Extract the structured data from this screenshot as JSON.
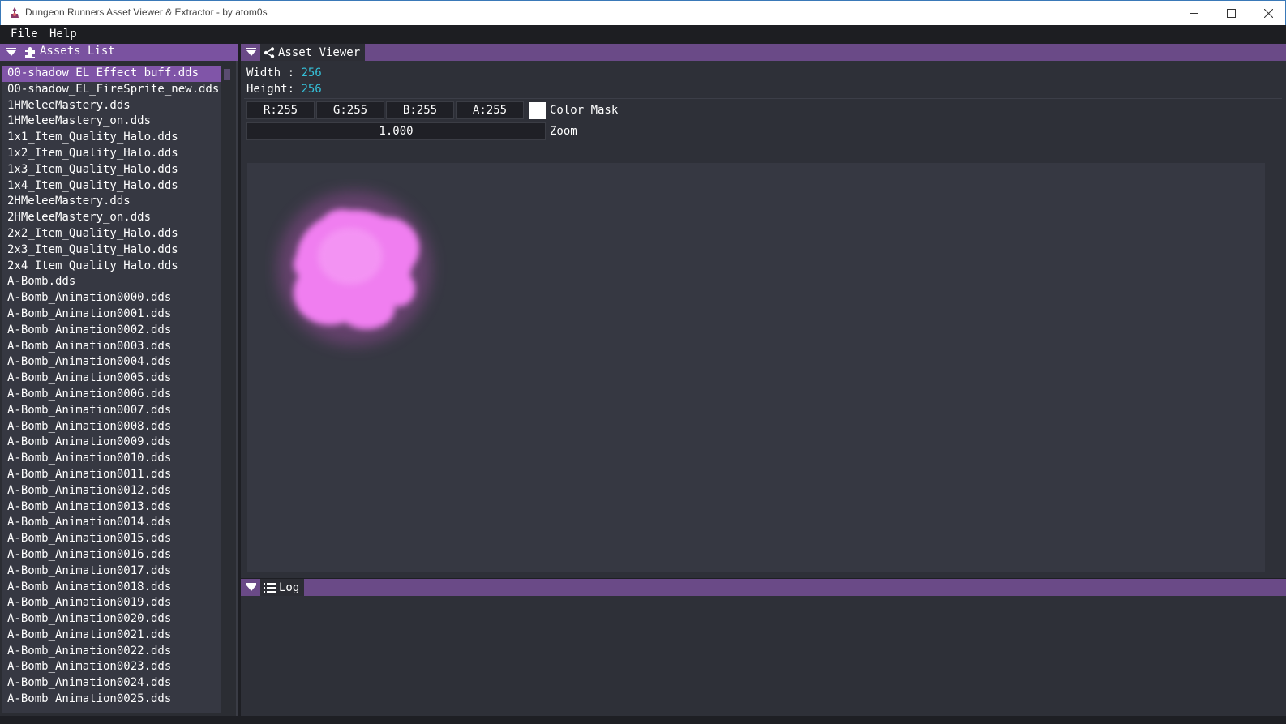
{
  "window": {
    "title": "Dungeon Runners Asset Viewer & Extractor - by atom0s"
  },
  "menu": [
    "File",
    "Help"
  ],
  "assets_panel": {
    "title": "Assets List",
    "selected_index": 0,
    "items": [
      "00-shadow_EL_Effect_buff.dds",
      "00-shadow_EL_FireSprite_new.dds",
      "1HMeleeMastery.dds",
      "1HMeleeMastery_on.dds",
      "1x1_Item_Quality_Halo.dds",
      "1x2_Item_Quality_Halo.dds",
      "1x3_Item_Quality_Halo.dds",
      "1x4_Item_Quality_Halo.dds",
      "2HMeleeMastery.dds",
      "2HMeleeMastery_on.dds",
      "2x2_Item_Quality_Halo.dds",
      "2x3_Item_Quality_Halo.dds",
      "2x4_Item_Quality_Halo.dds",
      "A-Bomb.dds",
      "A-Bomb_Animation0000.dds",
      "A-Bomb_Animation0001.dds",
      "A-Bomb_Animation0002.dds",
      "A-Bomb_Animation0003.dds",
      "A-Bomb_Animation0004.dds",
      "A-Bomb_Animation0005.dds",
      "A-Bomb_Animation0006.dds",
      "A-Bomb_Animation0007.dds",
      "A-Bomb_Animation0008.dds",
      "A-Bomb_Animation0009.dds",
      "A-Bomb_Animation0010.dds",
      "A-Bomb_Animation0011.dds",
      "A-Bomb_Animation0012.dds",
      "A-Bomb_Animation0013.dds",
      "A-Bomb_Animation0014.dds",
      "A-Bomb_Animation0015.dds",
      "A-Bomb_Animation0016.dds",
      "A-Bomb_Animation0017.dds",
      "A-Bomb_Animation0018.dds",
      "A-Bomb_Animation0019.dds",
      "A-Bomb_Animation0020.dds",
      "A-Bomb_Animation0021.dds",
      "A-Bomb_Animation0022.dds",
      "A-Bomb_Animation0023.dds",
      "A-Bomb_Animation0024.dds",
      "A-Bomb_Animation0025.dds"
    ]
  },
  "viewer": {
    "title": "Asset Viewer",
    "width_label": "Width :",
    "width_value": "256",
    "height_label": "Height:",
    "height_value": "256",
    "channels": [
      "R:255",
      "G:255",
      "B:255",
      "A:255"
    ],
    "mask_color": "#ffffff",
    "mask_label": "Color Mask",
    "zoom_value": "1.000",
    "zoom_label": "Zoom"
  },
  "log": {
    "title": "Log"
  },
  "colors": {
    "accent": "#7a52a0",
    "header": "#6a4a87",
    "selection": "#8055a8",
    "value": "#35c0d8",
    "sprite": "#f07ef0"
  }
}
